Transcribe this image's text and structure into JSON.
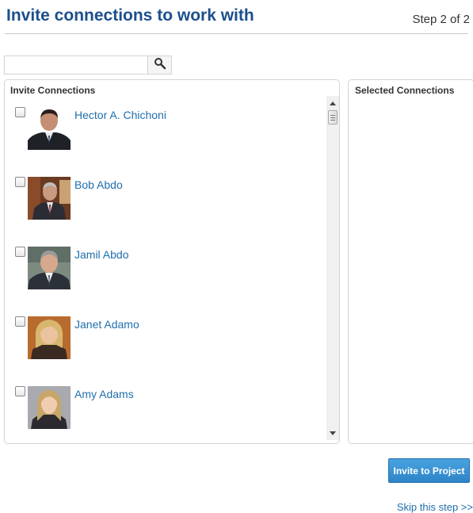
{
  "header": {
    "title": "Invite connections to work with",
    "step": "Step 2 of 2"
  },
  "search": {
    "placeholder": "",
    "value": "",
    "icon": "search-icon"
  },
  "invite_panel": {
    "heading": "Invite Connections",
    "connections": [
      {
        "name": "Hector A. Chichoni",
        "checked": false
      },
      {
        "name": "Bob Abdo",
        "checked": false
      },
      {
        "name": "Jamil Abdo",
        "checked": false
      },
      {
        "name": "Janet Adamo",
        "checked": false
      },
      {
        "name": "Amy Adams",
        "checked": false
      }
    ]
  },
  "selected_panel": {
    "heading": "Selected Connections"
  },
  "actions": {
    "invite_label": "Invite to Project",
    "skip_label": "Skip this step >>"
  },
  "colors": {
    "title": "#1c4f8c",
    "link": "#1f6fae",
    "button": "#2c84c7"
  }
}
